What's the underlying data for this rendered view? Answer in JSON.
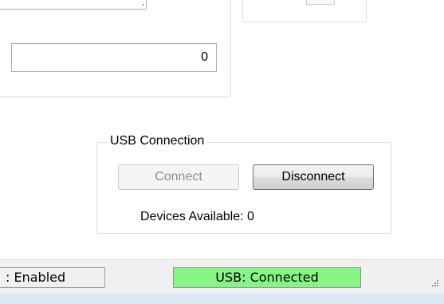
{
  "fields": {
    "value_field": "0"
  },
  "usb_connection": {
    "group_title": "USB Connection",
    "connect_label": "Connect",
    "disconnect_label": "Disconnect",
    "devices_available": "Devices Available: 0"
  },
  "status_bar": {
    "left_status": ": Enabled",
    "usb_status": "USB: Connected",
    "usb_status_color": "#86f586"
  },
  "colors": {
    "window_background": "#ffffff",
    "statusbar_background": "#f0f0f0",
    "bottom_band": "#dfe9f5"
  }
}
